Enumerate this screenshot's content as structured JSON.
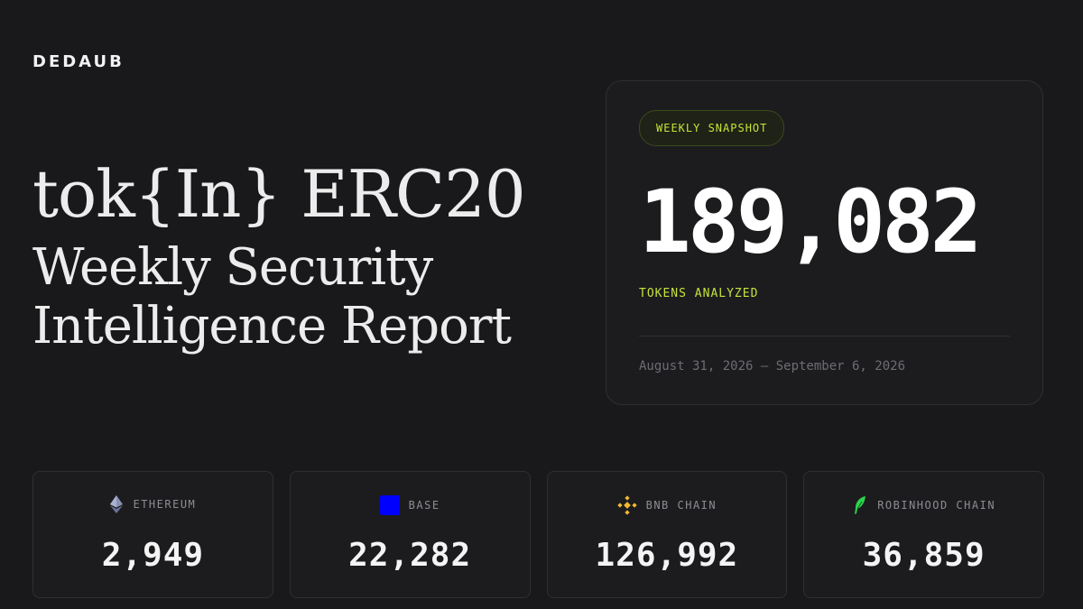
{
  "brand": {
    "logo_text": "DEDAUB"
  },
  "title": {
    "line1": "tok{In} ERC20",
    "line2": "Weekly Security",
    "line3": "Intelligence Report"
  },
  "snapshot": {
    "badge": "WEEKLY SNAPSHOT",
    "total_tokens": "189,082",
    "label": "TOKENS ANALYZED",
    "date_range": "August 31, 2026 – September 6, 2026",
    "accent_color": "#c6e33a"
  },
  "chains": [
    {
      "name": "ETHEREUM",
      "icon": "ethereum-icon",
      "value": "2,949",
      "color": "#8a92b2"
    },
    {
      "name": "BASE",
      "icon": "base-icon",
      "value": "22,282",
      "color": "#0000ff"
    },
    {
      "name": "BNB CHAIN",
      "icon": "bnb-icon",
      "value": "126,992",
      "color": "#f3ba2f"
    },
    {
      "name": "ROBINHOOD CHAIN",
      "icon": "robinhood-icon",
      "value": "36,859",
      "color": "#2cd44a"
    }
  ]
}
